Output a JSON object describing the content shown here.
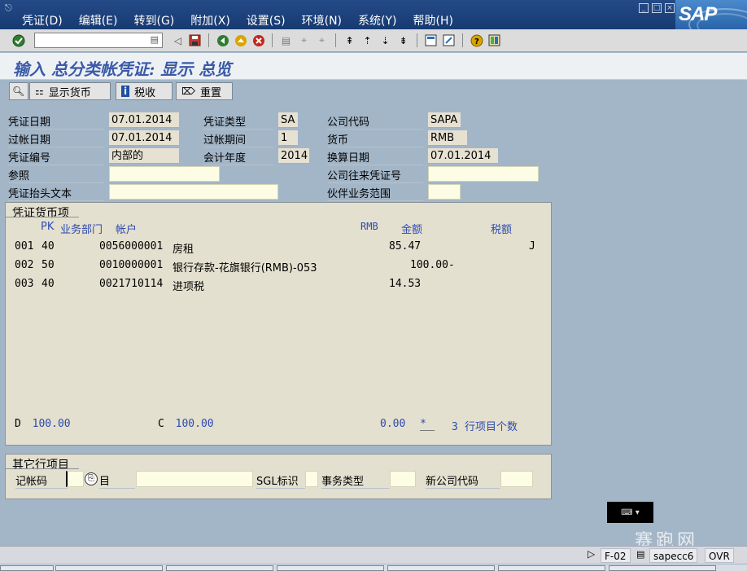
{
  "menubar": {
    "items": [
      "凭证(D)",
      "编辑(E)",
      "转到(G)",
      "附加(X)",
      "设置(S)",
      "环境(N)",
      "系统(Y)",
      "帮助(H)"
    ],
    "logo": "SAP"
  },
  "toolbar": {
    "command_value": "",
    "icons": [
      "enter-icon",
      "save-icon",
      "back-icon",
      "exit-icon",
      "cancel-icon",
      "print-icon",
      "find-icon",
      "find-next-icon",
      "first-page-icon",
      "prev-page-icon",
      "next-page-icon",
      "last-page-icon",
      "new-session-icon",
      "shortcut-icon",
      "help-icon",
      "layout-icon"
    ]
  },
  "title": "输入 总分类帐凭证: 显示 总览",
  "app_toolbar": {
    "display_currency": "显示货币",
    "tax": "税收",
    "reset": "重置"
  },
  "header": {
    "doc_date_label": "凭证日期",
    "doc_date": "07.01.2014",
    "doc_type_label": "凭证类型",
    "doc_type": "SA",
    "company_code_label": "公司代码",
    "company_code": "SAPA",
    "posting_date_label": "过帐日期",
    "posting_date": "07.01.2014",
    "period_label": "过帐期间",
    "period": "1",
    "currency_label": "货币",
    "currency": "RMB",
    "doc_no_label": "凭证编号",
    "doc_no": "内部的",
    "fiscal_year_label": "会计年度",
    "fiscal_year": "2014",
    "translation_date_label": "换算日期",
    "translation_date": "07.01.2014",
    "reference_label": "参照",
    "reference": "",
    "intercompany_label": "公司往来凭证号",
    "intercompany": "",
    "header_text_label": "凭证抬头文本",
    "header_text": "",
    "trading_partner_label": "伙伴业务范围",
    "trading_partner": ""
  },
  "items_panel": {
    "tab": "凭证货币项",
    "col_pk": "PK",
    "col_bus_area": "业务部门",
    "col_account": "帐户",
    "col_currency": "RMB",
    "col_amount": "金额",
    "col_tax": "税额",
    "rows": [
      {
        "no": "001",
        "pk": "40",
        "account": "0056000001",
        "desc": "房租",
        "amount": "85.47",
        "tax": "J"
      },
      {
        "no": "002",
        "pk": "50",
        "account": "0010000001",
        "desc": "银行存款-花旗银行(RMB)-053",
        "amount": "100.00-",
        "tax": ""
      },
      {
        "no": "003",
        "pk": "40",
        "account": "0021710114",
        "desc": "进项税",
        "amount": "14.53",
        "tax": ""
      }
    ],
    "debit_label": "D",
    "debit_total": "100.00",
    "credit_label": "C",
    "credit_total": "100.00",
    "balance": "0.00",
    "balance_flag": "*",
    "item_count": "3",
    "item_count_label": "行项目个数"
  },
  "other_item": {
    "tab": "其它行项目",
    "posting_key_label": "记帐码",
    "account_label": "目",
    "sgl_label": "SGL标识",
    "trans_type_label": "事务类型",
    "new_company_label": "新公司代码"
  },
  "statusbar": {
    "tcode": "F-02",
    "server": "sapecc6",
    "mode": "OVR"
  },
  "watermark": "赛跑网",
  "colors": {
    "menubar": "#1a3f7a",
    "background": "#a3b6c8",
    "panel": "#e4e0cf",
    "title_text": "#3a5aa8",
    "column_header_text": "#2d4ab0"
  }
}
